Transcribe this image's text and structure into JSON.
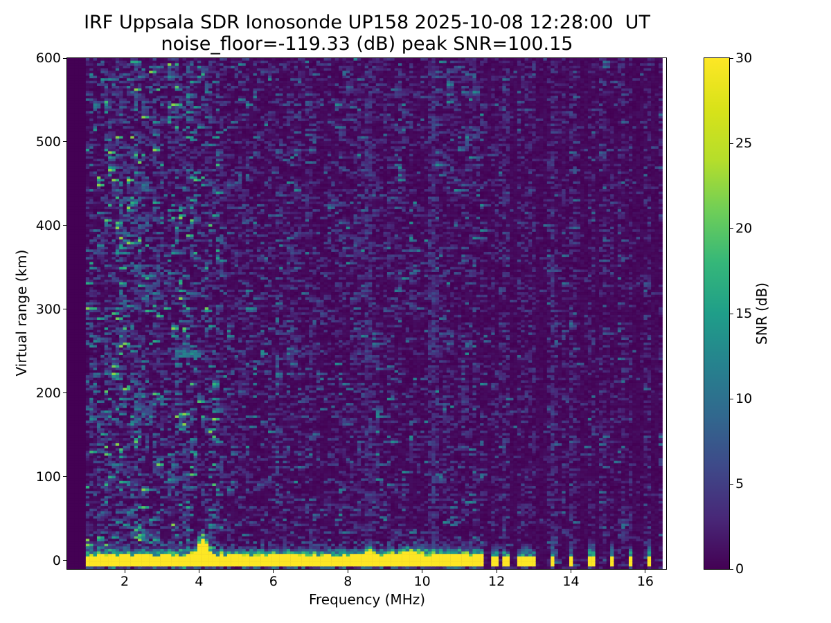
{
  "chart_data": {
    "type": "heatmap",
    "title": "IRF Uppsala SDR Ionosonde UP158 2025-10-08 12:28:00  UT",
    "subtitle": "noise_floor=-119.33 (dB) peak SNR=100.15",
    "xlabel": "Frequency (MHz)",
    "ylabel": "Virtual range (km)",
    "colorbar_label": "SNR (dB)",
    "noise_floor_db": -119.33,
    "peak_snr_db": 100.15,
    "xlim": [
      0.454,
      16.56
    ],
    "ylim": [
      -10,
      600
    ],
    "clim": [
      0,
      30
    ],
    "xticks": [
      2,
      4,
      6,
      8,
      10,
      12,
      14,
      16
    ],
    "yticks": [
      0,
      100,
      200,
      300,
      400,
      500,
      600
    ],
    "colorbar_ticks": [
      0,
      5,
      10,
      15,
      20,
      25,
      30
    ],
    "grid": false,
    "legend": "none (colorbar on right)",
    "colormap": "viridis",
    "colormap_stops": [
      "#440154",
      "#482878",
      "#3e4989",
      "#31688e",
      "#26828e",
      "#1f9e89",
      "#35b779",
      "#6ece58",
      "#b5de2b",
      "#d8e219",
      "#fde725"
    ],
    "data_freq_range": [
      0.92,
      16.454
    ],
    "freq_bin_mhz": 0.1,
    "range_bin_km": 3.0049,
    "features": {
      "ground_band": {
        "freq_start": 0.92,
        "freq_end": 11.65,
        "km_center": 0,
        "km_top_base": 6,
        "snr": 30
      },
      "band_bumps": [
        {
          "freq": 4.1,
          "extra_km": 18,
          "sigma": 0.17
        },
        {
          "freq": 8.6,
          "extra_km": 5,
          "sigma": 0.12
        },
        {
          "freq": 9.65,
          "extra_km": 4,
          "sigma": 0.28
        }
      ],
      "comb_bars_mhz": [
        11.75,
        11.89,
        12.03,
        12.17,
        12.31,
        12.45,
        12.59,
        12.73,
        12.87,
        13.01
      ],
      "comb_bar_halfwidth_mhz": 0.045,
      "wide_comb_bar_mhz": 12.73,
      "wide_comb_bar_halfwidth_mhz": 0.08,
      "isolated_bars_mhz": [
        13.48,
        13.98,
        14.55,
        15.08,
        15.62,
        16.08
      ],
      "isolated_bar_halfwidth_mhz": 0.055,
      "interference_lines_mhz": [
        8.55,
        10.25,
        13.5
      ],
      "noise_blob": {
        "freq_range": [
          2.28,
          2.9
        ],
        "km_range": [
          162,
          200
        ],
        "snr_max": 13
      },
      "echo_dash": {
        "freq_range": [
          3.35,
          4.05
        ],
        "km_range": [
          242,
          250
        ],
        "snr_max": 12
      }
    },
    "noise": {
      "seed": 42,
      "zones": [
        {
          "freq_max": 4.6,
          "dash_prob": 0.3,
          "amp": 3.2,
          "snr_max": 22,
          "streak_enter_prob": 0.03
        },
        {
          "freq_max": 11.65,
          "dash_prob": 0.2,
          "amp": 2.3,
          "snr_max": 13,
          "streak_enter_prob": 0.012
        },
        {
          "freq_max": 16.56,
          "dash_prob": 0.05,
          "amp": 2.0,
          "snr_max": 10,
          "streak_enter_prob": 0.006
        }
      ]
    }
  }
}
